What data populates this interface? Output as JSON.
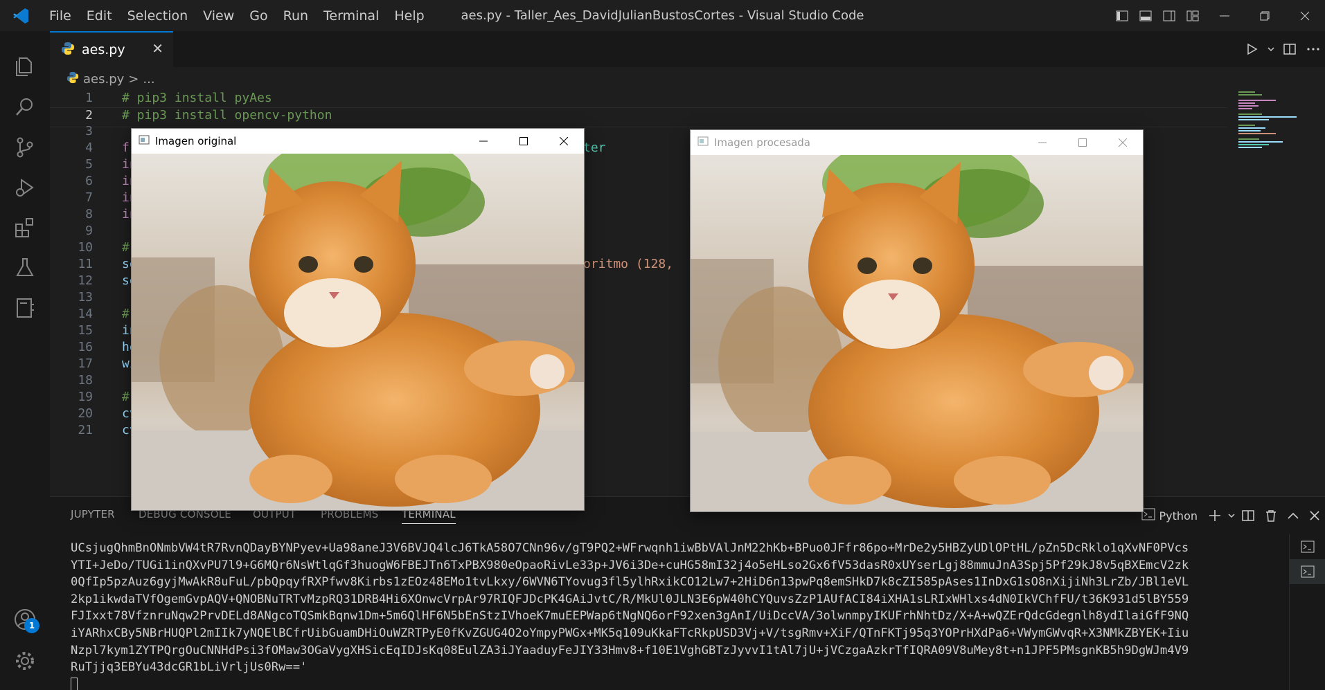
{
  "window_title": "aes.py - Taller_Aes_DavidJulianBustosCortes - Visual Studio Code",
  "menu": [
    "File",
    "Edit",
    "Selection",
    "View",
    "Go",
    "Run",
    "Terminal",
    "Help"
  ],
  "tab": {
    "label": "aes.py",
    "close": "✕"
  },
  "breadcrumb": {
    "file": "aes.py",
    "sep": ">",
    "rest": "..."
  },
  "code_lines": [
    {
      "n": "1",
      "text": "# pip3 install pyAes"
    },
    {
      "n": "2",
      "text": "# pip3 install opencv-python"
    },
    {
      "n": "3",
      "text": ""
    },
    {
      "n": "4",
      "text": "fr"
    },
    {
      "n": "5",
      "text": "in"
    },
    {
      "n": "6",
      "text": "in"
    },
    {
      "n": "7",
      "text": "in"
    },
    {
      "n": "8",
      "text": "in"
    },
    {
      "n": "9",
      "text": ""
    },
    {
      "n": "10",
      "text": "#"
    },
    {
      "n": "11",
      "text": "se"
    },
    {
      "n": "12",
      "text": "se"
    },
    {
      "n": "13",
      "text": ""
    },
    {
      "n": "14",
      "text": "#"
    },
    {
      "n": "15",
      "text": "in"
    },
    {
      "n": "16",
      "text": "he"
    },
    {
      "n": "17",
      "text": "wi"
    },
    {
      "n": "18",
      "text": ""
    },
    {
      "n": "19",
      "text": "#"
    },
    {
      "n": "20",
      "text": "cv"
    },
    {
      "n": "21",
      "text": "cv"
    }
  ],
  "code_fragments": {
    "line4_tail": "ter",
    "line11_tail": "oritmo (128,"
  },
  "panel_tabs": [
    "JUPYTER",
    "DEBUG CONSOLE",
    "OUTPUT",
    "PROBLEMS",
    "TERMINAL"
  ],
  "panel_active_tab": "TERMINAL",
  "terminal_shell": "Python",
  "terminal_lines": [
    "UCsjugQhmBnONmbVW4tR7RvnQDayBYNPyev+Ua98aneJ3V6BVJQ4lcJ6TkA58O7CNn96v/gT9PQ2+WFrwqnh1iwBbVAlJnM22hKb+BPuo0JFfr86po+MrDe2y5HBZyUDlOPtHL/pZn5DcRklo1qXvNF0PVcs",
    "YTI+JeDo/TUGi1inQXvPU7l9+G6MQr6NsWtlqGf3huogW6FBEJTn6TxPBX980eOpaoRivLe33p+JV6i3De+cuHG58mI32j4o5eHLso2Gx6fV53dasR0xUYserLgj88mmuJnA3Spj5Pf29kJ8v5qBXEmcV2zk",
    "0QfIp5pzAuz6gyjMwAkR8uFuL/pbQpqyfRXPfwv8Kirbs1zEOz48EMo1tvLkxy/6WVN6TYovug3fl5ylhRxikCO12Lw7+2HiD6n13pwPq8emSHkD7k8cZI585pAses1InDxG1sO8nXijiNh3LrZb/JBl1eVL",
    "2kp1ikwdaTVfOgemGvpAQV+QNOBNuTRTvMzpRQ31DRB4Hi6XOnwcVrpAr97RIQFJDcPK4GAiJvtC/R/MkUl0JLN3E6pW40hCYQuvsZzP1AUfACI84iXHA1sLRIxWHlxs4dN0IkVChfFU/t36K931d5lBY559",
    "FJIxxt78VfznruNqw2PrvDELd8ANgcoTQSmkBqnw1Dm+5m6QlHF6N5bEnStzIVhoeK7muEEPWap6tNgNQ6orF92xen3gAnI/UiDccVA/3olwnmpyIKUFrhNhtDz/X+A+wQZErQdcGdegnlh8ydIlaiGfF9NQ",
    "iYARhxCBy5NBrHUQPl2mIIk7yNQElBCfrUibGuamDHiOuWZRTPyE0fKvZGUG4O2oYmpyPWGx+MK5q109uKkaFTcRkpUSD3Vj+V/tsgRmv+XiF/QTnFKTj95q3YOPrHXdPa6+VWymGWvqR+X3NMkZBYEK+Iiu",
    "Nzpl7kym1ZYTPQrgOuCNNHdPsi3fOMaw3OGaVygXHSicEqIDJsKq08EulZA3iJYaaduyFeJIY33Hmv8+f10E1VghGBTzJyvvI1tAl7jU+jVCzgaAzkrTfIQRA09V8uMey8t+n1JPF5PMsgnKB5h9DgWJm4V9",
    "RuTjjq3EBYu43dcGR1bLiVrljUs0Rw=='"
  ],
  "windows": {
    "original": {
      "title": "Imagen original"
    },
    "processed": {
      "title": "Imagen procesada"
    }
  },
  "badge_count": "1",
  "colors": {
    "accent": "#0078d4",
    "comment": "#6a9955",
    "bg": "#1e1e1e"
  }
}
